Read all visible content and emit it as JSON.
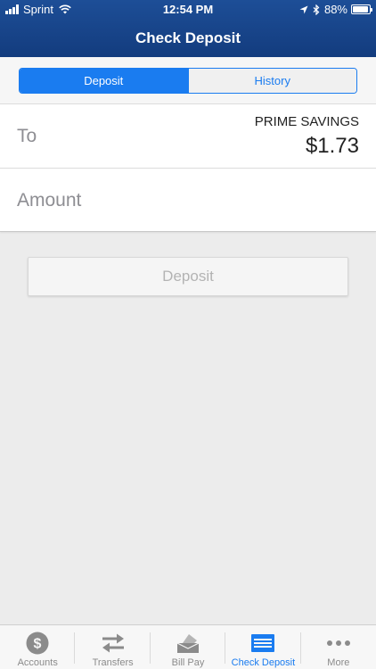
{
  "status_bar": {
    "carrier": "Sprint",
    "time": "12:54 PM",
    "battery": "88%",
    "battery_level": 0.88
  },
  "nav": {
    "title": "Check Deposit"
  },
  "segments": {
    "deposit": "Deposit",
    "history": "History",
    "selected": "deposit"
  },
  "form": {
    "to_label": "To",
    "account_name": "PRIME SAVINGS",
    "account_balance": "$1.73",
    "amount_placeholder": "Amount",
    "amount_value": ""
  },
  "actions": {
    "deposit_label": "Deposit"
  },
  "tabbar": {
    "items": [
      {
        "label": "Accounts",
        "icon": "dollar-coin-icon",
        "active": false
      },
      {
        "label": "Transfers",
        "icon": "transfer-arrows-icon",
        "active": false
      },
      {
        "label": "Bill Pay",
        "icon": "bill-pay-icon",
        "active": false
      },
      {
        "label": "Check Deposit",
        "icon": "check-deposit-icon",
        "active": true
      },
      {
        "label": "More",
        "icon": "more-dots-icon",
        "active": false
      }
    ]
  },
  "colors": {
    "header": "#1d4e97",
    "accent": "#1a7cf0",
    "background": "#ececec",
    "inactive_icon": "#8b8b8b"
  }
}
